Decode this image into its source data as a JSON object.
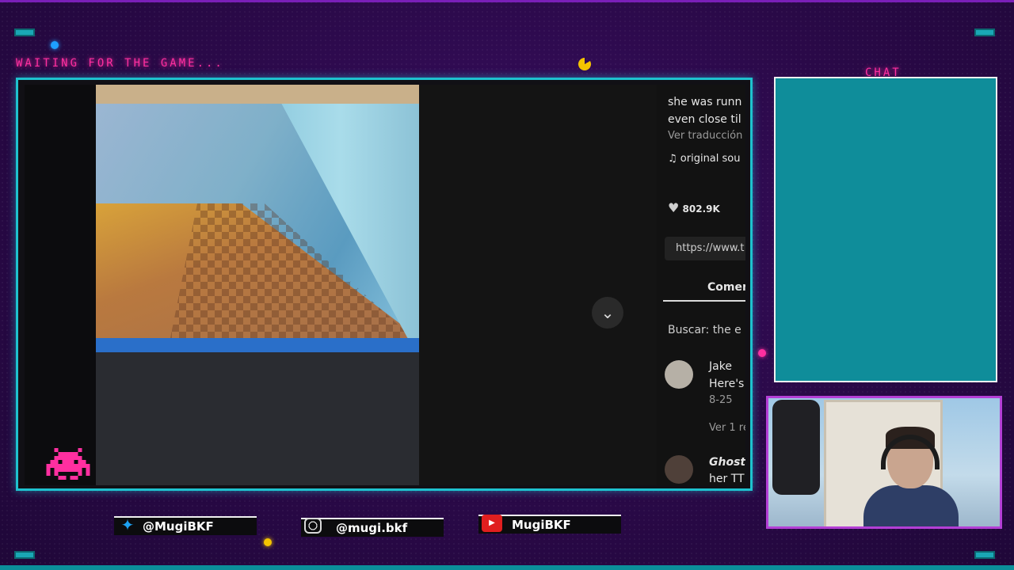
{
  "overlay": {
    "waiting_text": "WAITING FOR THE GAME...",
    "chat_title": "CHAT",
    "accent_colors": {
      "pink": "#ff2fa0",
      "cyan": "#1ec2cf",
      "purple_bg": "#2b0a4a",
      "chat_bg": "#0f8d9a"
    }
  },
  "video_panel": {
    "caption_line1": "she was runn",
    "caption_line2": "even close til",
    "translate_link": "Ver traducción",
    "sound_label": "original sou",
    "likes": "802.9K",
    "url_text": "https://www.t",
    "comments_tab": "Comen",
    "search_text": "Buscar: the e",
    "comments": [
      {
        "author": "Jake",
        "snippet": "Here's t",
        "date": "8-25",
        "replies": "Ver 1 re"
      },
      {
        "author": "Ghost_",
        "snippet": "her TT"
      }
    ]
  },
  "socials": {
    "twitter": "@MugiBKF",
    "instagram": "@mugi.bkf",
    "youtube": "MugiBKF"
  }
}
